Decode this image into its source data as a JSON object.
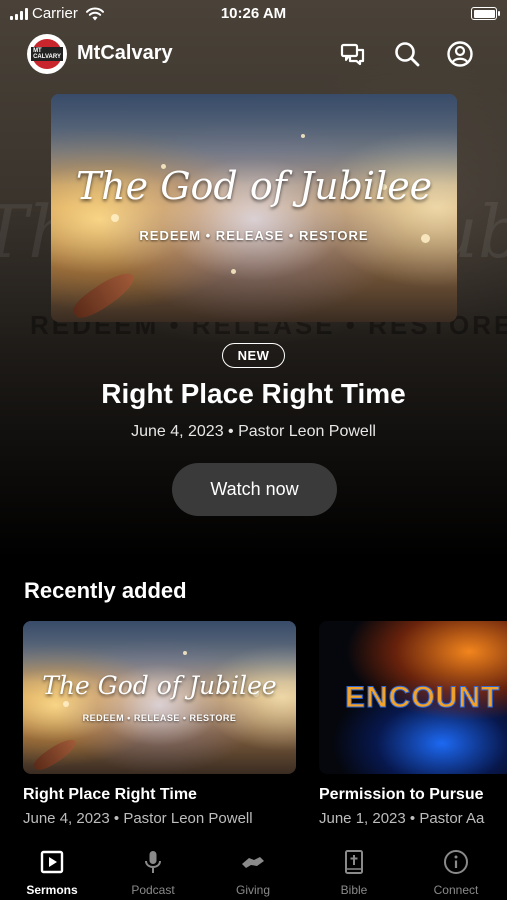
{
  "status_bar": {
    "carrier": "Carrier",
    "time": "10:26 AM"
  },
  "header": {
    "app_name": "MtCalvary",
    "logo_text": "MT CALVARY"
  },
  "hero": {
    "art_title": "The God of Jubilee",
    "art_subtitle": "REDEEM • RELEASE • RESTORE",
    "badge": "NEW",
    "title": "Right Place Right Time",
    "meta": "June 4, 2023 • Pastor Leon Powell",
    "button_label": "Watch now"
  },
  "recent": {
    "title": "Recently added",
    "items": [
      {
        "title": "Right Place Right Time",
        "meta": "June 4, 2023 • Pastor Leon Powell",
        "art_title": "The God of Jubilee",
        "art_subtitle": "REDEEM • RELEASE • RESTORE"
      },
      {
        "title": "Permission to Pursue",
        "meta": "June 1, 2023 • Pastor Aa",
        "art_text": "ENCOUNT"
      }
    ]
  },
  "tabs": [
    {
      "label": "Sermons",
      "icon": "play-square-icon",
      "active": true
    },
    {
      "label": "Podcast",
      "icon": "microphone-icon",
      "active": false
    },
    {
      "label": "Giving",
      "icon": "handshake-icon",
      "active": false
    },
    {
      "label": "Bible",
      "icon": "bible-icon",
      "active": false
    },
    {
      "label": "Connect",
      "icon": "info-icon",
      "active": false
    }
  ],
  "colors": {
    "background": "#000000",
    "button_bg": "#3a3a3a",
    "inactive_tab": "#8a8a8a",
    "logo_red": "#c8262c"
  }
}
